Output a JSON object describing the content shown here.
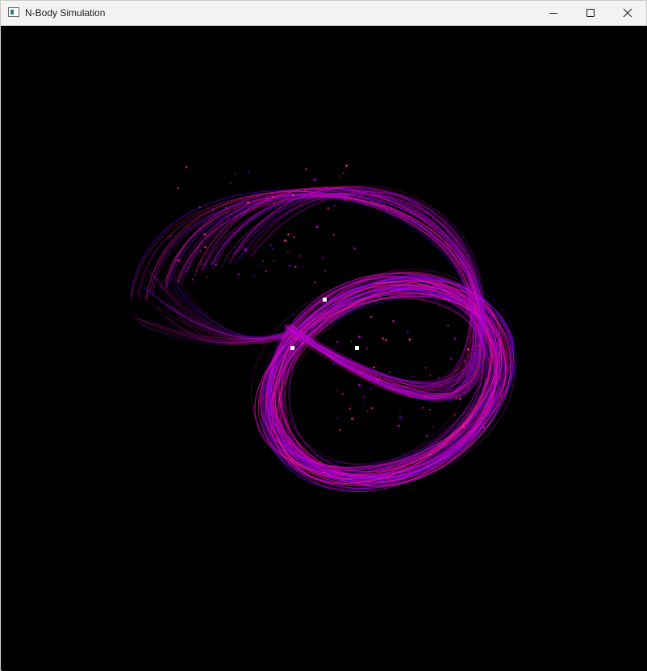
{
  "window": {
    "title": "N-Body Simulation",
    "icon": "window-app-icon",
    "controls": [
      "minimize-icon",
      "maximize-icon",
      "close-icon"
    ]
  },
  "scene": {
    "background": "#000000",
    "trail_colors": [
      "#a000c8",
      "#c800b4",
      "#6a00ff",
      "#ff1a8c",
      "#d000d0"
    ],
    "body_color": "#ffffff",
    "body_count": 3
  }
}
